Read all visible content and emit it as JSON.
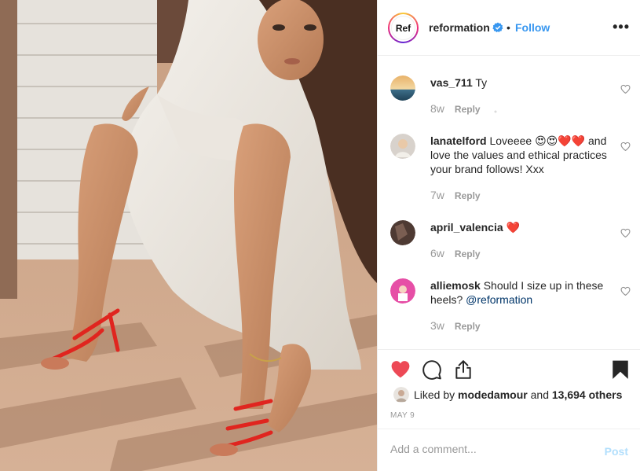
{
  "post": {
    "account": "reformation",
    "avatar_text": "Ref",
    "dot": "•",
    "follow_label": "Follow",
    "more_label": "•••"
  },
  "comments": [
    {
      "user": "vas_711",
      "text": " Ty",
      "time": "8w",
      "reply": "Reply"
    },
    {
      "user": "lanatelford",
      "text": " Loveeee 😍😍❤️❤️ and love the values and ethical practices your brand follows! Xxx",
      "time": "7w",
      "reply": "Reply"
    },
    {
      "user": "april_valencia",
      "text": " ❤️",
      "time": "6w",
      "reply": "Reply"
    },
    {
      "user": "alliemosk",
      "text": " Should I size up in these heels? ",
      "mention": "@reformation",
      "time": "3w",
      "reply": "Reply"
    }
  ],
  "likes": {
    "prefix": "Liked by ",
    "liker": "modedamour",
    "middle": " and ",
    "count": "13,694 others"
  },
  "date": "MAY 9",
  "add_comment": {
    "placeholder": "Add a comment...",
    "post_label": "Post"
  },
  "colors": {
    "accent": "#3897f0",
    "like_red": "#ed4956",
    "post_disabled": "#b2dffc"
  },
  "icons": [
    "verified-badge-icon",
    "heart-filled-icon",
    "comment-icon",
    "share-icon",
    "bookmark-filled-icon",
    "heart-outline-icon"
  ]
}
